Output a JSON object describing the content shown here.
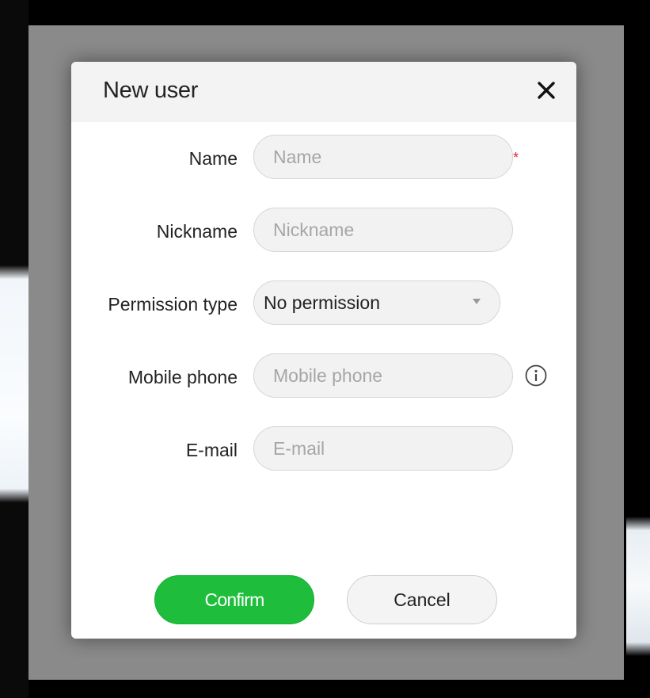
{
  "dialog": {
    "title": "New user",
    "close_icon": "close-icon"
  },
  "form": {
    "name": {
      "label": "Name",
      "placeholder": "Name",
      "value": "",
      "required_mark": "*"
    },
    "nickname": {
      "label": "Nickname",
      "placeholder": "Nickname",
      "value": ""
    },
    "permission_type": {
      "label": "Permission type",
      "selected": "No permission",
      "icon": "chevron-down-icon"
    },
    "mobile_phone": {
      "label": "Mobile phone",
      "placeholder": "Mobile phone",
      "value": "",
      "info_icon": "info-icon"
    },
    "email": {
      "label": "E-mail",
      "placeholder": "E-mail",
      "value": ""
    }
  },
  "buttons": {
    "confirm_label": "Confirm",
    "cancel_label": "Cancel"
  },
  "colors": {
    "confirm_bg": "#1ebe3c",
    "required_star": "#e0262b",
    "overlay": "#8a8a8a"
  }
}
